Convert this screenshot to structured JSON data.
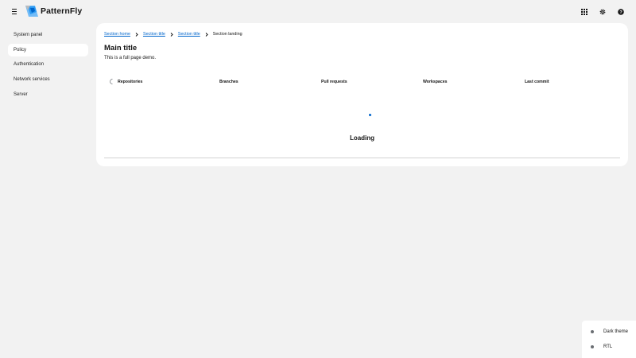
{
  "header": {
    "brand": "PatternFly",
    "tools": [
      "grid-icon",
      "gear-icon",
      "help-icon"
    ]
  },
  "sidebar": {
    "items": [
      {
        "label": "System panel",
        "active": false
      },
      {
        "label": "Policy",
        "active": true
      },
      {
        "label": "Authentication",
        "active": false
      },
      {
        "label": "Network services",
        "active": false
      },
      {
        "label": "Server",
        "active": false
      }
    ]
  },
  "breadcrumb": {
    "links": [
      "Section home",
      "Section title",
      "Section title"
    ],
    "current": "Section landing"
  },
  "main": {
    "title": "Main title",
    "description": "This is a full page demo.",
    "columns": [
      "Repositories",
      "Branches",
      "Pull requests",
      "Workspaces",
      "Last commit"
    ],
    "loading_text": "Loading"
  },
  "theme_panel": {
    "dark_theme_label": "Dark theme",
    "rtl_label": "RTL"
  },
  "colors": {
    "accent": "#0066cc",
    "background": "#f2f2f2",
    "surface": "#ffffff"
  }
}
